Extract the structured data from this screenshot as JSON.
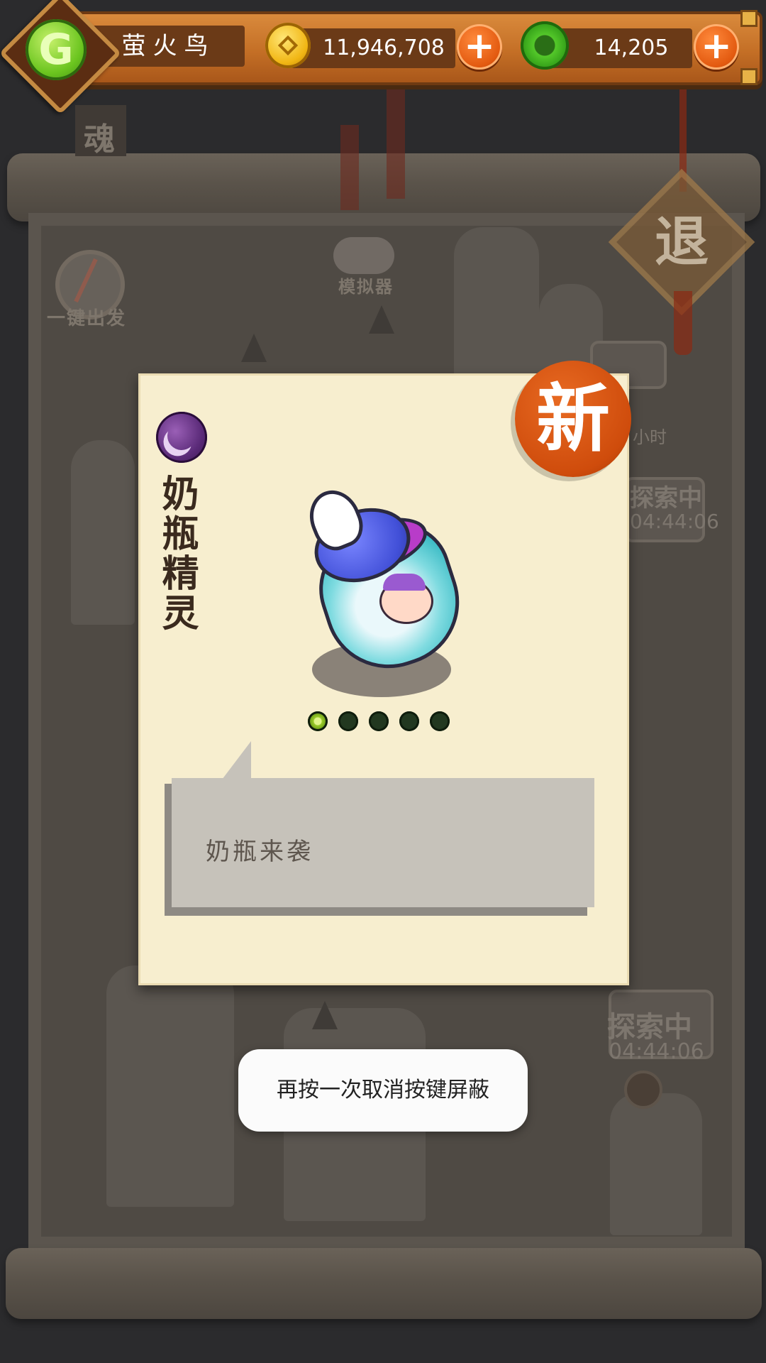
{
  "header": {
    "player_name": "萤火鸟",
    "gold_amount": "11,946,708",
    "jade_amount": "14,205",
    "add_symbol": "+"
  },
  "background": {
    "one_key_depart": "一键出发",
    "emulator": "模拟器",
    "quit": "退",
    "soul_tab": "魂",
    "explore_status": "探索中",
    "explore_timer": "04:44:06",
    "hours_suffix": "小时"
  },
  "card": {
    "spirit_name": "奶瓶精灵",
    "new_badge": "新",
    "description": "奶瓶来袭",
    "star_rating": 1,
    "star_max": 5,
    "element_icon": "moon-element-icon"
  },
  "toast": {
    "message": "再按一次取消按键屏蔽"
  },
  "colors": {
    "topbar": "#c46f26",
    "card_bg": "#f7eecf",
    "new_badge": "#cf4c0c",
    "speech_box": "#c6c2ba"
  }
}
